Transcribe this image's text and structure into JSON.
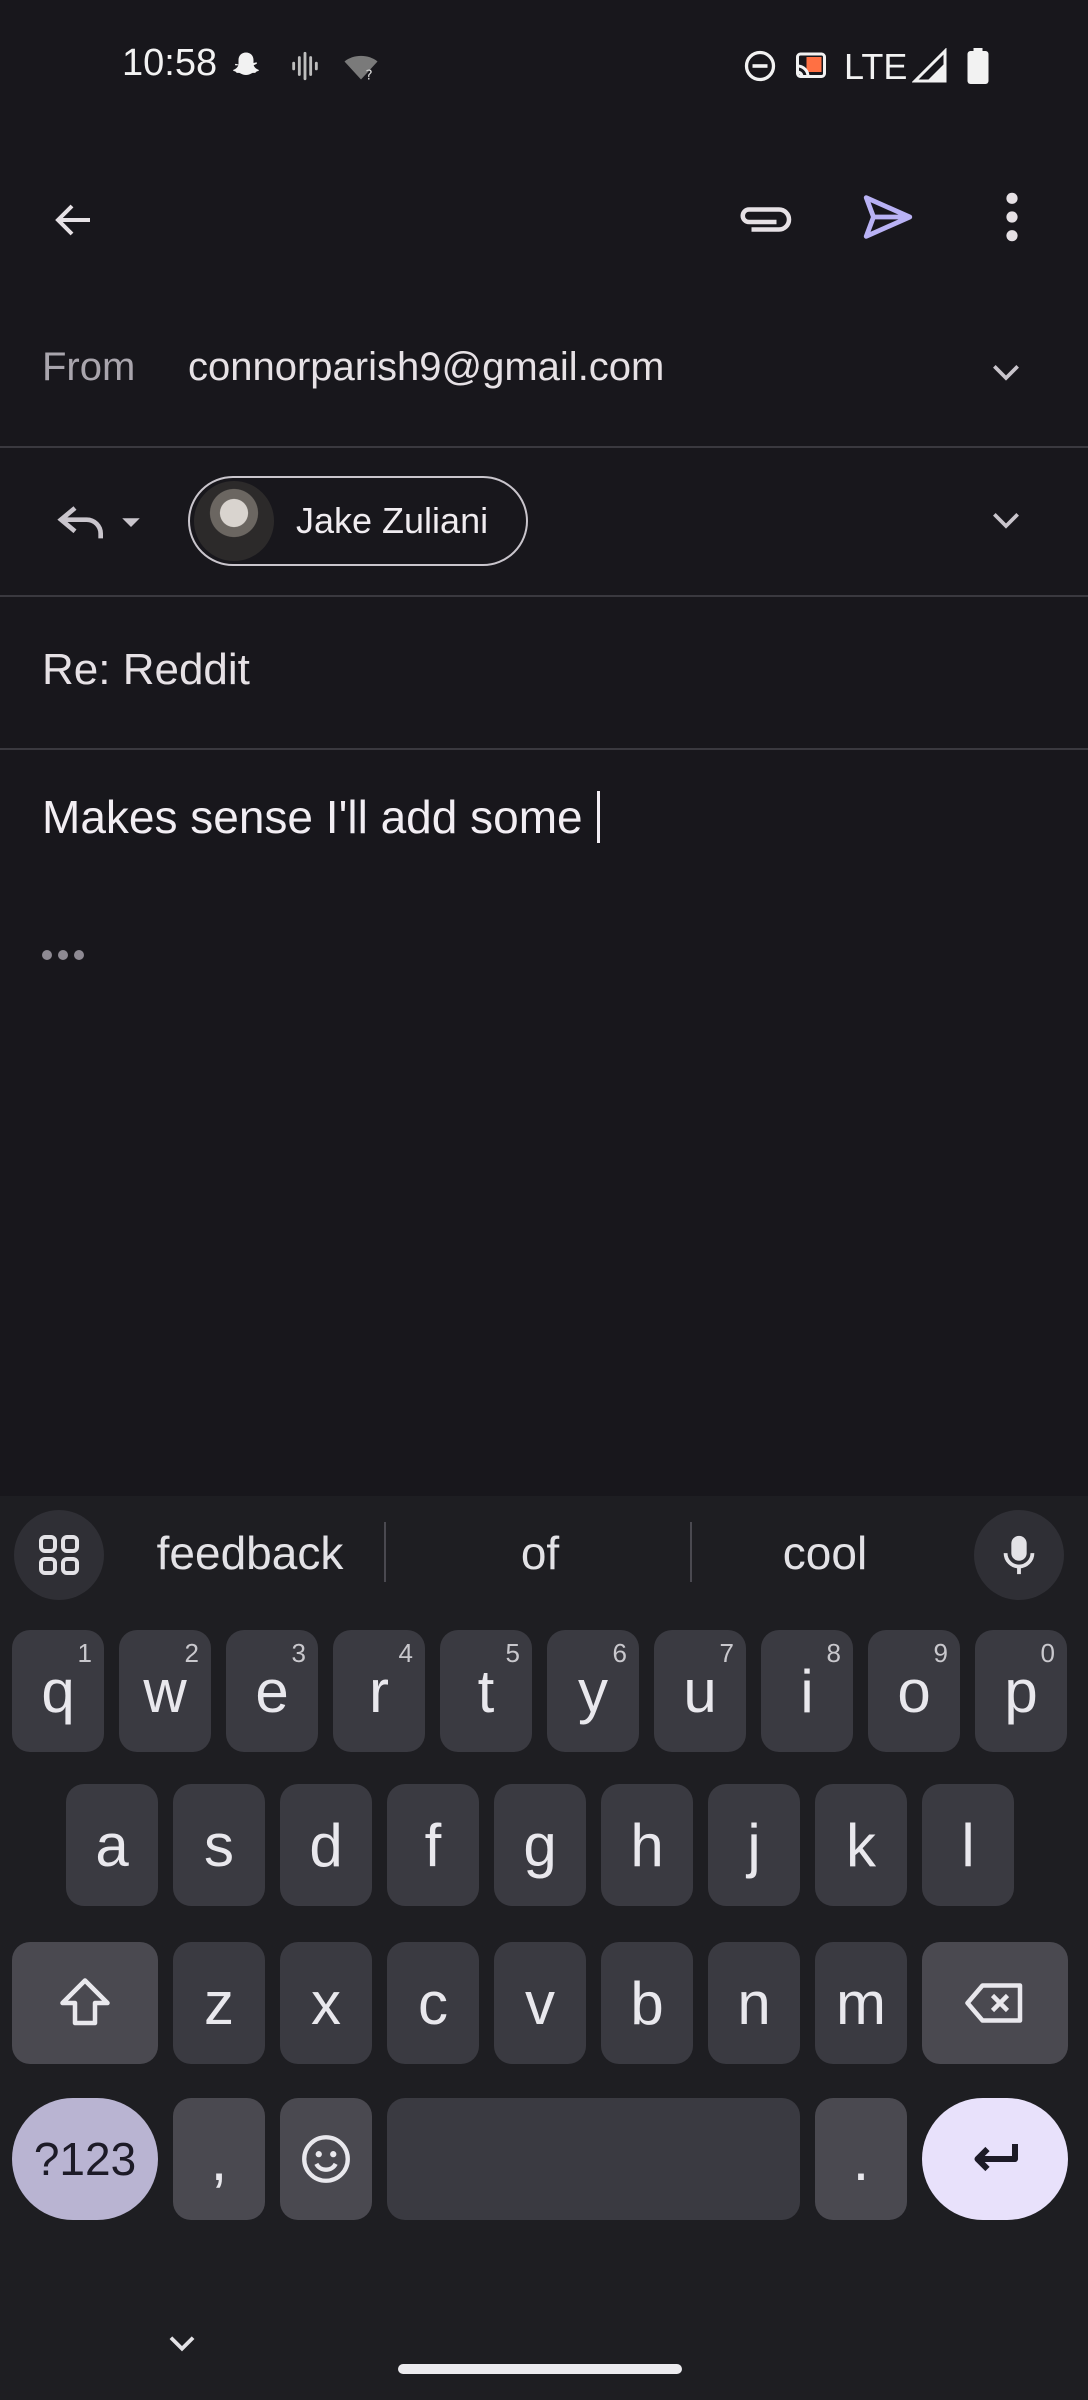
{
  "status_bar": {
    "time": "10:58",
    "network": "LTE"
  },
  "toolbar": {
    "back_icon": "arrow-back-icon",
    "attach_icon": "paperclip-icon",
    "send_icon": "send-icon",
    "more_icon": "more-vert-icon"
  },
  "compose": {
    "from_label": "From",
    "from_email": "connorparish9@gmail.com",
    "recipient_name": "Jake Zuliani",
    "subject": "Re: Reddit",
    "body": "Makes sense I'll add some "
  },
  "keyboard": {
    "suggestions": [
      "feedback",
      "of",
      "cool"
    ],
    "row1": [
      {
        "key": "q",
        "hint": "1"
      },
      {
        "key": "w",
        "hint": "2"
      },
      {
        "key": "e",
        "hint": "3"
      },
      {
        "key": "r",
        "hint": "4"
      },
      {
        "key": "t",
        "hint": "5"
      },
      {
        "key": "y",
        "hint": "6"
      },
      {
        "key": "u",
        "hint": "7"
      },
      {
        "key": "i",
        "hint": "8"
      },
      {
        "key": "o",
        "hint": "9"
      },
      {
        "key": "p",
        "hint": "0"
      }
    ],
    "row2": [
      "a",
      "s",
      "d",
      "f",
      "g",
      "h",
      "j",
      "k",
      "l"
    ],
    "row3": [
      "z",
      "x",
      "c",
      "v",
      "b",
      "n",
      "m"
    ],
    "symbols_label": "?123",
    "comma_label": ",",
    "period_label": "."
  },
  "colors": {
    "background": "#18171c",
    "accent_send": "#b9b2f5",
    "keyboard_bg": "#1e1e22",
    "key_bg": "#3a3a41"
  }
}
